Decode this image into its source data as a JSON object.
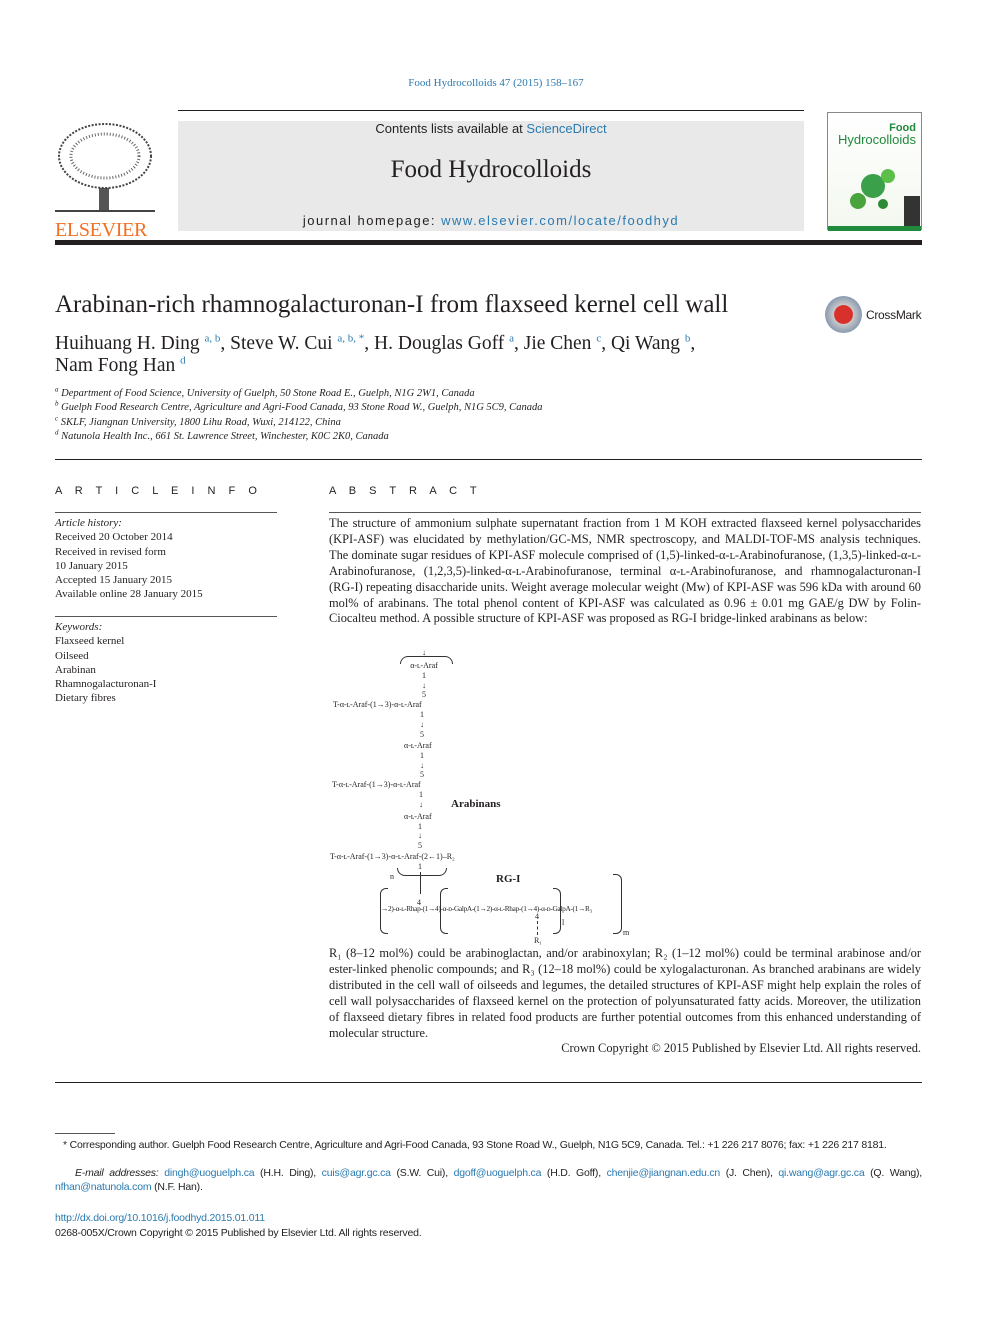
{
  "header": {
    "citation": "Food Hydrocolloids 47 (2015) 158–167",
    "contents_prefix": "Contents lists available at ",
    "contents_link": "ScienceDirect",
    "journal": "Food Hydrocolloids",
    "homepage_prefix": "journal homepage: ",
    "homepage_link": "www.elsevier.com/locate/foodhyd",
    "publisher_logo": "ELSEVIER",
    "cover_title_1": "Food",
    "cover_title_2": "Hydrocolloids",
    "crossmark": "CrossMark",
    "colors": {
      "link": "#2a7ab0",
      "elsevier": "#f36f21",
      "cover_green": "#1f8a3c"
    }
  },
  "article": {
    "title": "Arabinan-rich rhamnogalacturonan-I from flaxseed kernel cell wall",
    "authors": [
      {
        "name": "Huihuang H. Ding",
        "sup": "a, b"
      },
      {
        "name": "Steve W. Cui",
        "sup": "a, b, *"
      },
      {
        "name": "H. Douglas Goff",
        "sup": "a"
      },
      {
        "name": "Jie Chen",
        "sup": "c"
      },
      {
        "name": "Qi Wang",
        "sup": "b"
      },
      {
        "name": "Nam Fong Han",
        "sup": "d"
      }
    ],
    "affiliations": [
      {
        "sup": "a",
        "text": "Department of Food Science, University of Guelph, 50 Stone Road E., Guelph, N1G 2W1, Canada"
      },
      {
        "sup": "b",
        "text": "Guelph Food Research Centre, Agriculture and Agri-Food Canada, 93 Stone Road W., Guelph, N1G 5C9, Canada"
      },
      {
        "sup": "c",
        "text": "SKLF, Jiangnan University, 1800 Lihu Road, Wuxi, 214122, China"
      },
      {
        "sup": "d",
        "text": "Natunola Health Inc., 661 St. Lawrence Street, Winchester, K0C 2K0, Canada"
      }
    ]
  },
  "info": {
    "heading": "A R T I C L E   I N F O",
    "history_label": "Article history:",
    "history": [
      "Received 20 October 2014",
      "Received in revised form",
      "10 January 2015",
      "Accepted 15 January 2015",
      "Available online 28 January 2015"
    ],
    "keywords_label": "Keywords:",
    "keywords": [
      "Flaxseed kernel",
      "Oilseed",
      "Arabinan",
      "Rhamnogalacturonan-I",
      "Dietary fibres"
    ]
  },
  "abstract": {
    "heading": "A B S T R A C T",
    "p1": "The structure of ammonium sulphate supernatant fraction from 1 M KOH extracted flaxseed kernel polysaccharides (KPI-ASF) was elucidated by methylation/GC-MS, NMR spectroscopy, and MALDI-TOF-MS analysis techniques. The dominate sugar residues of KPI-ASF molecule comprised of (1,5)-linked-α-ʟ-Arabinofuranose, (1,3,5)-linked-α-ʟ-Arabinofuranose, (1,2,3,5)-linked-α-ʟ-Arabinofuranose, terminal α-ʟ-Arabinofuranose, and rhamnogalacturonan-I (RG-I) repeating disaccharide units. Weight average molecular weight (Mw) of KPI-ASF was 596 kDa with around 60 mol% of arabinans. The total phenol content of KPI-ASF was calculated as 0.96 ± 0.01 mg GAE/g DW by Folin-Ciocalteu method. A possible structure of KPI-ASF was proposed as RG-I bridge-linked arabinans as below:",
    "p2": "R₁ (8–12 mol%) could be arabinoglactan, and/or arabinoxylan; R₂ (1–12 mol%) could be terminal arabinose and/or ester-linked phenolic compounds; and R₃ (12–18 mol%) could be xylogalacturonan. As branched arabinans are widely distributed in the cell wall of oilseeds and legumes, the detailed structures of KPI-ASF might help explain the roles of cell wall polysaccharides of flaxseed kernel on the protection of polyunsaturated fatty acids. Moreover, the utilization of flaxseed dietary fibres in related food products are further potential outcomes from this enhanced understanding of molecular structure.",
    "copyright": "Crown Copyright © 2015 Published by Elsevier Ltd. All rights reserved.",
    "structure": {
      "top_residue": "α-ʟ-Araf",
      "branch1": "T-α-ʟ-Araf-(1→3)-α-ʟ-Araf",
      "mid": "α-ʟ-Araf",
      "branch2": "T-α-ʟ-Araf-(1→3)-α-ʟ-Araf",
      "arabinans": "Arabinans",
      "lower": "α-ʟ-Araf",
      "branch3": "T-α-ʟ-Araf-(1→3)-α-ʟ-Araf-(2←1)–R₂",
      "n": "n",
      "rgi": "RG-I",
      "backbone": "→2)-α-ʟ-Rhap-(1→4)-α-ᴅ-GalpA-(1→2)-α-ʟ-Rhap-(1→4)-α-ᴅ-GalpA-(1→R₃",
      "four": "4",
      "r1": "R₁",
      "l": "l",
      "m": "m",
      "one": "1",
      "five": "5",
      "arrow": "↓"
    }
  },
  "footnotes": {
    "corresponding": "* Corresponding author. Guelph Food Research Centre, Agriculture and Agri-Food Canada, 93 Stone Road W., Guelph, N1G 5C9, Canada. Tel.: +1 226 217 8076; fax: +1 226 217 8181.",
    "email_label": "E-mail addresses: ",
    "emails": [
      {
        "email": "dingh@uoguelph.ca",
        "who": " (H.H. Ding), "
      },
      {
        "email": "cuis@agr.gc.ca",
        "who": " (S.W. Cui), "
      },
      {
        "email": "dgoff@uoguelph.ca",
        "who": " (H.D. Goff), "
      },
      {
        "email": "chenjie@jiangnan.edu.cn",
        "who": " (J. Chen), "
      },
      {
        "email": "qi.wang@agr.gc.ca",
        "who": " (Q. Wang), "
      },
      {
        "email": "nfhan@natunola.com",
        "who": " (N.F. Han)."
      }
    ],
    "doi": "http://dx.doi.org/10.1016/j.foodhyd.2015.01.011",
    "issn": "0268-005X/Crown Copyright © 2015 Published by Elsevier Ltd. All rights reserved."
  }
}
